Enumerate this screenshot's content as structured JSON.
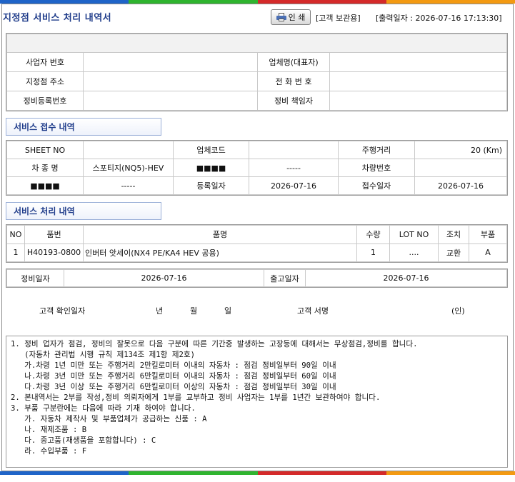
{
  "colors": {
    "stripe": [
      "#1f64c8",
      "#2fb42f",
      "#d42a2a",
      "#f39a12"
    ]
  },
  "header": {
    "title": "지정점 서비스 처리 내역서",
    "print_label": "인 쇄",
    "copy_label": "[고객 보관용]",
    "print_date": "[출력일자 : 2026-07-16 17:13:30]"
  },
  "dealer": {
    "biz_no_label": "사업자 번호",
    "biz_no": "",
    "company_label": "업체명(대표자)",
    "company": "",
    "address_label": "지정점 주소",
    "address": "",
    "phone_label": "전 화 번 호",
    "phone": "",
    "reg_no_label": "정비등록번호",
    "reg_no": "",
    "manager_label": "정비 책임자",
    "manager": ""
  },
  "reception": {
    "section_title": "서비스 접수 내역",
    "sheet_no_label": "SHEET NO",
    "sheet_no": "",
    "company_code_label": "업체코드",
    "company_code": "",
    "mileage_label": "주행거리",
    "mileage": "20 (Km)",
    "model_label": "차 종 명",
    "model": "스포티지(NQ5)-HEV",
    "masked_label_1": "■■■■",
    "masked_value_1": "-----",
    "plate_label": "차량번호",
    "plate": "",
    "masked_label_2": "■■■■",
    "masked_value_2": "-----",
    "reg_date_label": "등록일자",
    "reg_date": "2026-07-16",
    "recv_date_label": "접수일자",
    "recv_date": "2026-07-16"
  },
  "processing": {
    "section_title": "서비스 처리 내역",
    "columns": [
      "NO",
      "품번",
      "품명",
      "수량",
      "LOT NO",
      "조치",
      "부품"
    ],
    "rows": [
      [
        "1",
        "H40193-0800",
        "인버터 앗세이(NX4 PE/KA4 HEV 공용)",
        "1",
        "....",
        "교환",
        "A"
      ]
    ]
  },
  "dates": {
    "repair_date_label": "정비일자",
    "repair_date": "2026-07-16",
    "release_date_label": "출고일자",
    "release_date": "2026-07-16"
  },
  "confirm": {
    "customer_date_label": "고객 확인일자",
    "year": "년",
    "month": "월",
    "day": "일",
    "signature_label": "고객 서명",
    "seal": "(인)"
  },
  "notes": [
    "1. 정비 업자가 점검, 정비의 잘못으로 다음 구분에 따른 기간중 발생하는 고장등에 대해서는 무상점검,정비를 합니다.",
    "   (자동차 관리법 시행 규칙 제134조 제1항 제2호)",
    "   가.차령 1년 미만 또는 주행거리 2만킬로미터 이내의 자동차 : 점검 정비일부터 90일 이내",
    "   나.차령 3년 미만 또는 주행거리 6만킬로미터 이내의 자동차 : 점검 정비일부터 60일 이내",
    "   다.차령 3년 이상 또는 주행거리 6만킬로미터 이상의 자동차 : 점검 정비일부터 30일 이내",
    "2. 본내역서는 2부를 작성,정비 의뢰자에게 1부를 교부하고 정비 사업자는 1부를 1년간 보관하여야 합니다.",
    "3. 부품 구분란에는 다음에 따라 기재 하여야 합니다.",
    "   가. 자동차 제작사 및 부품업체가 공급하는 신품 : A",
    "   나. 재제조품 : B",
    "   다. 중고품(재생품을 포함합니다) : C",
    "   라. 수입부품 : F"
  ]
}
